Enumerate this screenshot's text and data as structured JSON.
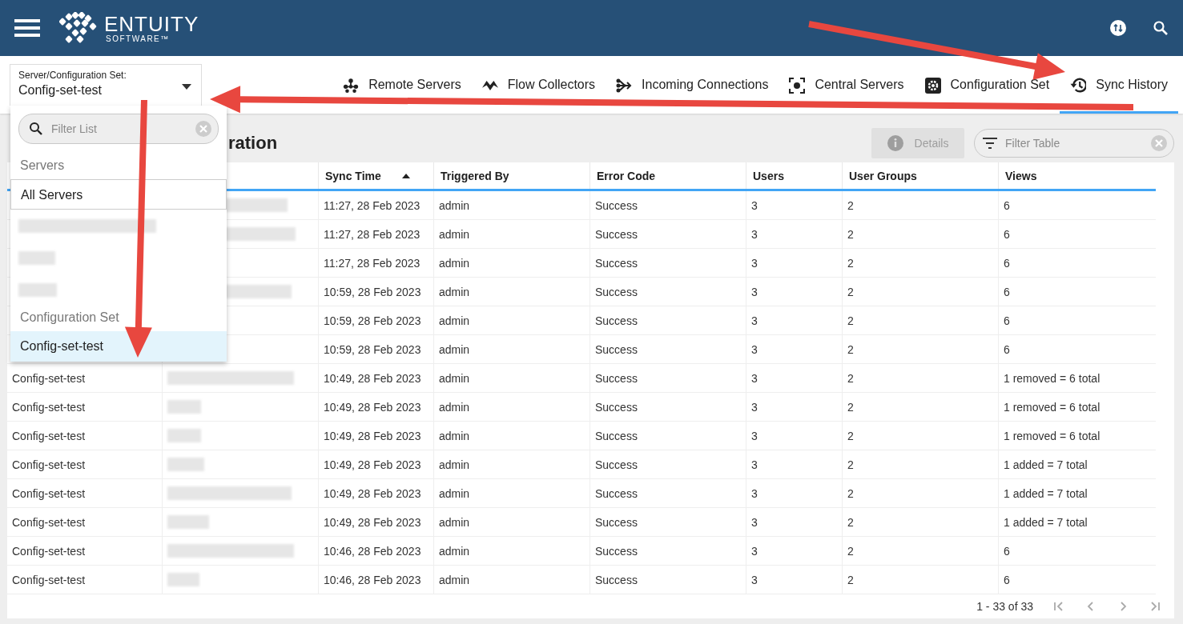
{
  "header": {
    "logo_text": "ENTUITY",
    "logo_subtext": "SOFTWARE™"
  },
  "selector": {
    "label": "Server/Configuration Set:",
    "value": "Config-set-test",
    "expanded": true
  },
  "dropdown": {
    "filter": {
      "placeholder": "Filter List"
    },
    "items": [
      {
        "kind": "section",
        "label": "Servers"
      },
      {
        "kind": "option",
        "label": "All Servers",
        "selected": false
      },
      {
        "kind": "blurred"
      },
      {
        "kind": "blurred"
      },
      {
        "kind": "blurred"
      },
      {
        "kind": "section",
        "label": "Configuration Set"
      },
      {
        "kind": "option",
        "label": "Config-set-test",
        "selected": true
      }
    ]
  },
  "tabs": [
    {
      "label": "Remote Servers",
      "selected": false
    },
    {
      "label": "Flow Collectors",
      "selected": false
    },
    {
      "label": "Incoming Connections",
      "selected": false
    },
    {
      "label": "Central Servers",
      "selected": false
    },
    {
      "label": "Configuration Set",
      "selected": false
    },
    {
      "label": "Sync History",
      "selected": true
    }
  ],
  "panel": {
    "title": "ration",
    "details_button": {
      "label": "Details",
      "disabled": true
    },
    "filter": {
      "placeholder": "Filter Table"
    }
  },
  "table": {
    "columns": [
      {
        "label": "Sync Time",
        "sorted": true
      },
      {
        "label": "Triggered By",
        "sorted": false
      },
      {
        "label": "Error Code",
        "sorted": false
      },
      {
        "label": "Users",
        "sorted": false
      },
      {
        "label": "User Groups",
        "sorted": false
      },
      {
        "label": "Views",
        "sorted": false
      }
    ],
    "rows": [
      {
        "sync_time": "11:27, 28 Feb 2023",
        "triggered_by": "admin",
        "error_code": "Success",
        "users": "3",
        "user_groups": "2",
        "views": "6"
      },
      {
        "sync_time": "11:27, 28 Feb 2023",
        "triggered_by": "admin",
        "error_code": "Success",
        "users": "3",
        "user_groups": "2",
        "views": "6"
      },
      {
        "sync_time": "11:27, 28 Feb 2023",
        "triggered_by": "admin",
        "error_code": "Success",
        "users": "3",
        "user_groups": "2",
        "views": "6"
      },
      {
        "sync_time": "10:59, 28 Feb 2023",
        "triggered_by": "admin",
        "error_code": "Success",
        "users": "3",
        "user_groups": "2",
        "views": "6"
      },
      {
        "sync_time": "10:59, 28 Feb 2023",
        "triggered_by": "admin",
        "error_code": "Success",
        "users": "3",
        "user_groups": "2",
        "views": "6"
      },
      {
        "sync_time": "10:59, 28 Feb 2023",
        "triggered_by": "admin",
        "error_code": "Success",
        "users": "3",
        "user_groups": "2",
        "views": "6"
      },
      {
        "column_1": "Config-set-test",
        "sync_time": "10:49, 28 Feb 2023",
        "triggered_by": "admin",
        "error_code": "Success",
        "users": "3",
        "user_groups": "2",
        "views": "1 removed = 6 total"
      },
      {
        "column_1": "Config-set-test",
        "sync_time": "10:49, 28 Feb 2023",
        "triggered_by": "admin",
        "error_code": "Success",
        "users": "3",
        "user_groups": "2",
        "views": "1 removed = 6 total"
      },
      {
        "column_1": "Config-set-test",
        "sync_time": "10:49, 28 Feb 2023",
        "triggered_by": "admin",
        "error_code": "Success",
        "users": "3",
        "user_groups": "2",
        "views": "1 removed = 6 total"
      },
      {
        "column_1": "Config-set-test",
        "sync_time": "10:49, 28 Feb 2023",
        "triggered_by": "admin",
        "error_code": "Success",
        "users": "3",
        "user_groups": "2",
        "views": "1 added = 7 total"
      },
      {
        "column_1": "Config-set-test",
        "sync_time": "10:49, 28 Feb 2023",
        "triggered_by": "admin",
        "error_code": "Success",
        "users": "3",
        "user_groups": "2",
        "views": "1 added = 7 total"
      },
      {
        "column_1": "Config-set-test",
        "sync_time": "10:49, 28 Feb 2023",
        "triggered_by": "admin",
        "error_code": "Success",
        "users": "3",
        "user_groups": "2",
        "views": "1 added = 7 total"
      },
      {
        "column_1": "Config-set-test",
        "sync_time": "10:46, 28 Feb 2023",
        "triggered_by": "admin",
        "error_code": "Success",
        "users": "3",
        "user_groups": "2",
        "views": "6"
      },
      {
        "column_1": "Config-set-test",
        "sync_time": "10:46, 28 Feb 2023",
        "triggered_by": "admin",
        "error_code": "Success",
        "users": "3",
        "user_groups": "2",
        "views": "6"
      }
    ]
  },
  "pagination": {
    "range": "1 - 33 of 33",
    "buttons": [
      {
        "kind": "first",
        "disabled": true
      },
      {
        "kind": "prev",
        "disabled": true
      },
      {
        "kind": "next",
        "disabled": true
      },
      {
        "kind": "last",
        "disabled": true
      }
    ]
  }
}
